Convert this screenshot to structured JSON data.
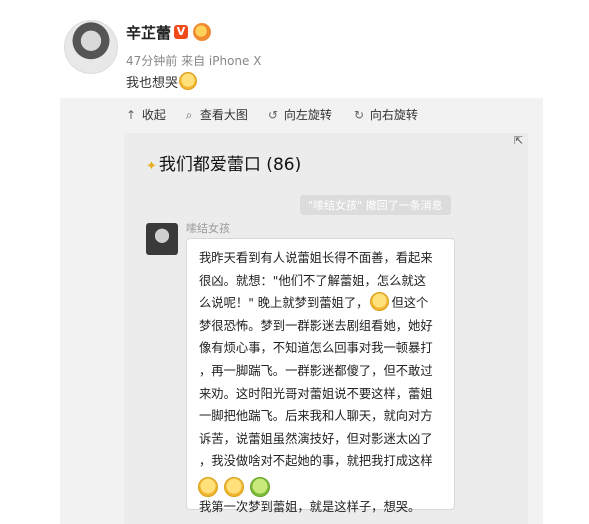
{
  "post": {
    "user_name": "辛芷蕾",
    "verified_badge": "V",
    "meta": "47分钟前 来自 iPhone X",
    "text": "我也想哭"
  },
  "toolbar": {
    "collapse": {
      "label": "收起",
      "icon": "arrow-up-icon"
    },
    "view_large": {
      "label": "查看大图",
      "icon": "search-icon"
    },
    "rotate_left": {
      "label": "向左旋转",
      "icon": "rotate-left-icon"
    },
    "rotate_right": {
      "label": "向右旋转",
      "icon": "rotate-right-icon"
    }
  },
  "screenshot": {
    "expand_glyph": "⇱",
    "chat_title": "我们都爱蕾口 (86)",
    "system_message": "\"嗦结女孩\" 撤回了一条消息",
    "sender_name": "嗦结女孩",
    "message_lines": [
      "我昨天看到有人说蕾姐长得不面善，看起来",
      "很凶。就想：\"他们不了解蕾姐，怎么就这",
      "么说呢！\" 晚上就梦到蕾姐了，",
      "但这个",
      "梦很恐怖。梦到一群影迷去剧组看她，她好",
      "像有烦心事，不知道怎么回事对我一顿暴打",
      "，再一脚踹飞。一群影迷都傻了，但不敢过",
      "来劝。这时阳光哥对蕾姐说不要这样，蕾姐",
      "一脚把他踹飞。后来我和人聊天，就向对方",
      "诉苦，说蕾姐虽然演技好，但对影迷太凶了",
      "，我没做啥对不起她的事，就把我打成这样",
      "。",
      "我第一次梦到蕾姐，就是这样子，想哭。"
    ]
  }
}
